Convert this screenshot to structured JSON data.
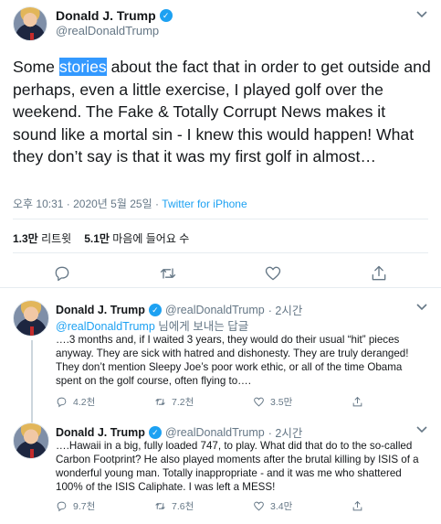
{
  "main_tweet": {
    "author_name": "Donald J. Trump",
    "author_handle": "@realDonaldTrump",
    "text_before": "Some ",
    "text_highlight": "stories",
    "text_after": " about the fact that in order to get outside and perhaps, even a little exercise, I played golf over the weekend. The Fake & Totally Corrupt News makes it sound like a mortal sin - I knew this would happen! What they don’t say is that it was my first golf in almost…",
    "timestamp": "오후 10:31 · 2020년 5월 25일 · ",
    "source": "Twitter for iPhone",
    "retweets_count": "1.3만",
    "retweets_label": "리트윗",
    "likes_count": "5.1만",
    "likes_label": "마음에 들어요 수",
    "icons": [
      "reply-icon",
      "retweet-icon",
      "like-icon",
      "share-icon"
    ]
  },
  "replies": [
    {
      "author_name": "Donald J. Trump",
      "author_handle": "@realDonaldTrump",
      "time": "· 2시간",
      "reply_to_mention": "@realDonaldTrump",
      "reply_to_suffix": " 님에게 보내는 답글",
      "text": "….3 months and, if I waited 3 years, they would do their usual “hit” pieces anyway. They are sick with hatred and dishonesty. They are truly deranged! They don’t mention Sleepy Joe’s poor work ethic,  or all of the time Obama spent on the golf course, often flying to….",
      "reply_count": "4.2천",
      "retweet_count": "7.2천",
      "like_count": "3.5만"
    },
    {
      "author_name": "Donald J. Trump",
      "author_handle": "@realDonaldTrump",
      "time": "· 2시간",
      "text": "….Hawaii in a big, fully loaded 747, to play. What did that do to the so-called Carbon Footprint? He also played moments after the brutal killing by ISIS of a wonderful young man. Totally inappropriate - and it was me who shattered 100% of the ISIS Caliphate. I was left a MESS!",
      "reply_count": "9.7천",
      "retweet_count": "7.6천",
      "like_count": "3.4만"
    }
  ],
  "colors": {
    "accent": "#1da1f2",
    "secondary_text": "#657786",
    "selection": "#3399ff"
  }
}
